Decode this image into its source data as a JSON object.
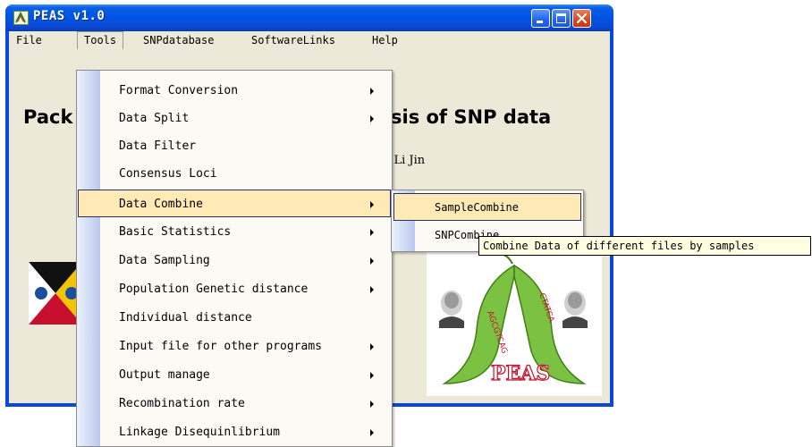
{
  "window": {
    "title": "PEAS v1.0",
    "icon": "peas-app-icon"
  },
  "menubar": {
    "items": [
      "File",
      "Tools",
      "SNPdatabase",
      "SoftwareLinks",
      "Help"
    ],
    "active": "Tools"
  },
  "content": {
    "heading_left": "Pack",
    "heading_right": "sis of SNP data",
    "authors_fragment": "d Li Jin"
  },
  "tools_menu": {
    "items": [
      {
        "label": "Format Conversion",
        "submenu": true
      },
      {
        "label": "Data Split",
        "submenu": true
      },
      {
        "label": "Data Filter",
        "submenu": false
      },
      {
        "label": "Consensus Loci",
        "submenu": false
      },
      {
        "label": "Data Combine",
        "submenu": true,
        "selected": true
      },
      {
        "label": "Basic Statistics",
        "submenu": true
      },
      {
        "label": "Data Sampling",
        "submenu": true
      },
      {
        "label": "Population Genetic distance",
        "submenu": true
      },
      {
        "label": "Individual distance",
        "submenu": false
      },
      {
        "label": "Input file for other programs",
        "submenu": true
      },
      {
        "label": "Output manage",
        "submenu": true
      },
      {
        "label": "Recombination rate",
        "submenu": true
      },
      {
        "label": "Linkage Disequinlibrium",
        "submenu": true
      }
    ]
  },
  "data_combine_submenu": {
    "items": [
      "SampleCombine",
      "SNPCombine"
    ],
    "selected": "SampleCombine"
  },
  "tooltip": {
    "text": "Combine Data of different files by samples"
  },
  "logo": {
    "text": "PEAS",
    "pod_letters_left": "AGCGTCAG",
    "pod_letters_right": "CTATCA"
  },
  "colors": {
    "titlebar": "#0054e3",
    "menu_highlight": "#ffeab6",
    "menu_highlight_border": "#2d2d66",
    "pea_green": "#7cc242"
  }
}
